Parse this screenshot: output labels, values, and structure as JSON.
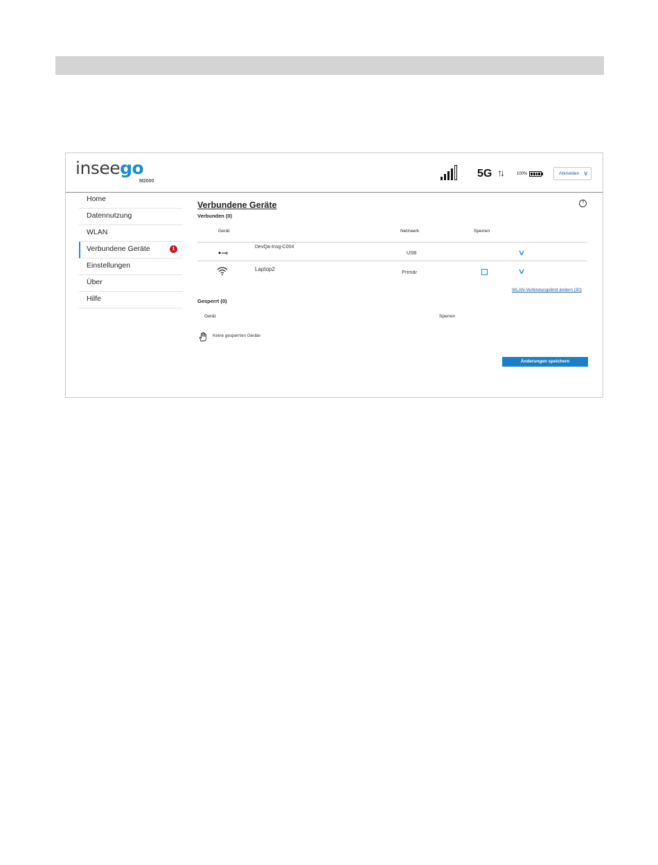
{
  "brand": {
    "logo_prefix": "insee",
    "logo_suffix": "go",
    "model": "M2000",
    "accent_color": "#1a8bd0"
  },
  "status": {
    "network": "5G",
    "transfer_arrows": "↑↓",
    "battery_percent": "100%",
    "signal_bars_filled": 4,
    "signal_bars_total": 5
  },
  "logout": {
    "label": "Abmelden"
  },
  "sidebar": {
    "items": [
      {
        "label": "Home"
      },
      {
        "label": "Datennutzung"
      },
      {
        "label": "WLAN"
      },
      {
        "label": "Verbundene Geräte",
        "active": true,
        "badge": "1"
      },
      {
        "label": "Einstellungen"
      },
      {
        "label": "Über"
      },
      {
        "label": "Hilfe"
      }
    ]
  },
  "main": {
    "title": "Verbundene Geräte",
    "help_icon": "?",
    "connected": {
      "title": "Verbunden (0)",
      "headers": {
        "device": "Gerät",
        "network": "Netzwerk",
        "block": "Sperren"
      },
      "rows": [
        {
          "icon": "usb-icon",
          "name": "DevQa-Insg-C004",
          "network": "USB"
        },
        {
          "icon": "wifi-icon",
          "name": "Laptop2",
          "network": "Primär",
          "block_checked": false
        }
      ],
      "limit_link": "WLAN-Verbindungslimit ändern (30)"
    },
    "blocked": {
      "title": "Gesperrt (0)",
      "headers": {
        "device": "Gerät",
        "block": "Sperren"
      },
      "empty_text": "Keine gesperrten Geräte"
    },
    "save_label": "Änderungen speichern"
  }
}
